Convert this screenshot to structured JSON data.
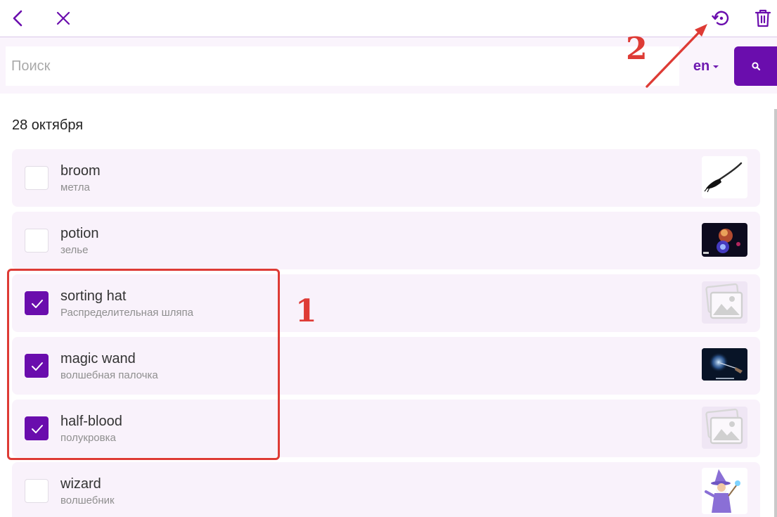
{
  "toolbar": {
    "icons": [
      "back-icon",
      "close-icon",
      "restore-icon",
      "trash-icon"
    ],
    "accent_color": "#6a0dad"
  },
  "search": {
    "placeholder": "Поиск",
    "value": "",
    "language": "en"
  },
  "list": {
    "date": "28 октября",
    "items": [
      {
        "word": "broom",
        "translation": "метла",
        "checked": false,
        "image": "broom"
      },
      {
        "word": "potion",
        "translation": "зелье",
        "checked": false,
        "image": "photo"
      },
      {
        "word": "sorting hat",
        "translation": "Распределительная шляпа",
        "checked": true,
        "image": "placeholder"
      },
      {
        "word": "magic wand",
        "translation": "волшебная палочка",
        "checked": true,
        "image": "photo"
      },
      {
        "word": "half-blood",
        "translation": "полукровка",
        "checked": true,
        "image": "placeholder"
      },
      {
        "word": "wizard",
        "translation": "волшебник",
        "checked": false,
        "image": "wizard"
      }
    ]
  },
  "annotations": {
    "label_1": "1",
    "label_2": "2",
    "color": "#de3b35"
  }
}
